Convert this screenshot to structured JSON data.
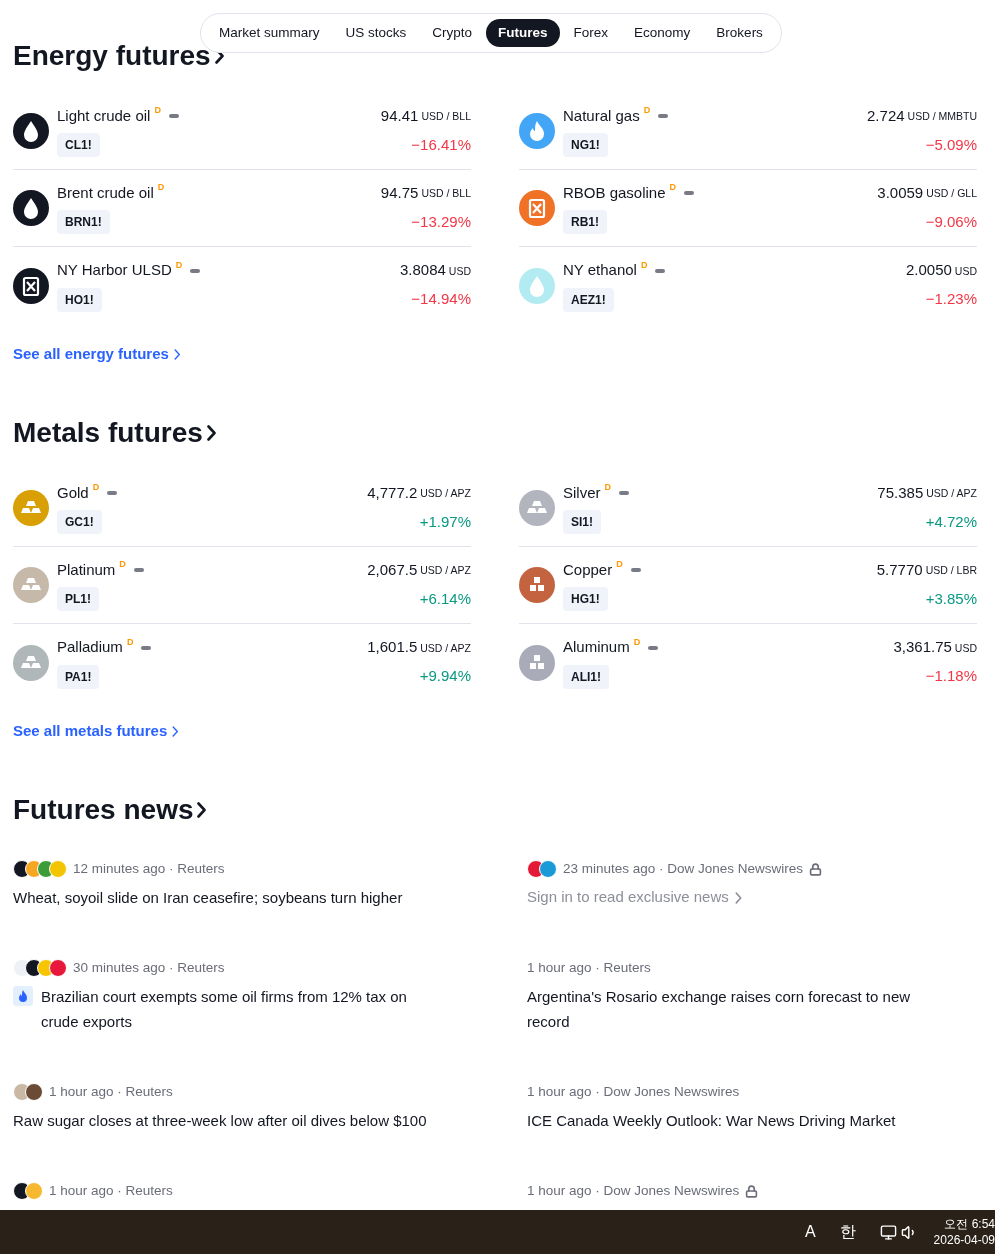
{
  "nav": {
    "tabs": [
      {
        "label": "Market summary",
        "selected": false
      },
      {
        "label": "US stocks",
        "selected": false
      },
      {
        "label": "Crypto",
        "selected": false
      },
      {
        "label": "Futures",
        "selected": true
      },
      {
        "label": "Forex",
        "selected": false
      },
      {
        "label": "Economy",
        "selected": false
      },
      {
        "label": "Brokers",
        "selected": false
      }
    ]
  },
  "sections": [
    {
      "title": "Energy futures",
      "link": "See all energy futures",
      "items": [
        {
          "name": "Light crude oil",
          "badge": "D",
          "dash": true,
          "symbol": "CL1!",
          "price": "94.41",
          "unit": "USD / BLL",
          "change": {
            "value": "−16.41%",
            "color": "#f23645"
          },
          "logo": {
            "kind": "drop",
            "color": "#131722"
          }
        },
        {
          "name": "Natural gas",
          "badge": "D",
          "dash": true,
          "symbol": "NG1!",
          "price": "2.724",
          "unit": "USD / MMBTU",
          "change": {
            "value": "−5.09%",
            "color": "#f23645"
          },
          "logo": {
            "kind": "flame",
            "color": "#42a5f5"
          }
        },
        {
          "name": "Brent crude oil",
          "badge": "D",
          "symbol": "BRN1!",
          "price": "94.75",
          "unit": "USD / BLL",
          "change": {
            "value": "−13.29%",
            "color": "#f23645"
          },
          "logo": {
            "kind": "drop",
            "color": "#131722"
          }
        },
        {
          "name": "RBOB gasoline",
          "badge": "D",
          "dash": true,
          "symbol": "RB1!",
          "price": "3.0059",
          "unit": "USD / GLL",
          "change": {
            "value": "−9.06%",
            "color": "#f23645"
          },
          "logo": {
            "kind": "canister",
            "color": "#f07227"
          }
        },
        {
          "name": "NY Harbor ULSD",
          "badge": "D",
          "dash": true,
          "symbol": "HO1!",
          "price": "3.8084",
          "unit": "USD",
          "change": {
            "value": "−14.94%",
            "color": "#f23645"
          },
          "logo": {
            "kind": "canister",
            "color": "#131722"
          }
        },
        {
          "name": "NY ethanol",
          "badge": "D",
          "dash": true,
          "symbol": "AEZ1!",
          "price": "2.0050",
          "unit": "USD",
          "change": {
            "value": "−1.23%",
            "color": "#f23645"
          },
          "logo": {
            "kind": "drop",
            "color": "#b2ebf2"
          }
        }
      ]
    },
    {
      "title": "Metals futures",
      "link": "See all metals futures",
      "items": [
        {
          "name": "Gold",
          "badge": "D",
          "dash": true,
          "symbol": "GC1!",
          "price": "4,777.2",
          "unit": "USD / APZ",
          "change": {
            "value": "+1.97%",
            "color": "#089981"
          },
          "logo": {
            "kind": "bars",
            "color": "#d9a005"
          }
        },
        {
          "name": "Silver",
          "badge": "D",
          "dash": true,
          "symbol": "SI1!",
          "price": "75.385",
          "unit": "USD / APZ",
          "change": {
            "value": "+4.72%",
            "color": "#089981"
          },
          "logo": {
            "kind": "bars",
            "color": "#b2b5be"
          }
        },
        {
          "name": "Platinum",
          "badge": "D",
          "dash": true,
          "symbol": "PL1!",
          "price": "2,067.5",
          "unit": "USD / APZ",
          "change": {
            "value": "+6.14%",
            "color": "#089981"
          },
          "logo": {
            "kind": "bars",
            "color": "#c6b9a9"
          }
        },
        {
          "name": "Copper",
          "badge": "D",
          "dash": true,
          "symbol": "HG1!",
          "price": "5.7770",
          "unit": "USD / LBR",
          "change": {
            "value": "+3.85%",
            "color": "#089981"
          },
          "logo": {
            "kind": "blocks",
            "color": "#c4633f"
          }
        },
        {
          "name": "Palladium",
          "badge": "D",
          "dash": true,
          "symbol": "PA1!",
          "price": "1,601.5",
          "unit": "USD / APZ",
          "change": {
            "value": "+9.94%",
            "color": "#089981"
          },
          "logo": {
            "kind": "bars",
            "color": "#b0b7b9"
          }
        },
        {
          "name": "Aluminum",
          "badge": "D",
          "dash": true,
          "symbol": "ALI1!",
          "price": "3,361.75",
          "unit": "USD",
          "change": {
            "value": "−1.18%",
            "color": "#f23645"
          },
          "logo": {
            "kind": "blocks",
            "color": "#a9abb8"
          }
        }
      ]
    }
  ],
  "news": {
    "title": "Futures news",
    "items": [
      {
        "kind": "story",
        "logos": [
          {
            "color": "#131722"
          },
          {
            "color": "#f5a623"
          },
          {
            "color": "#3a9d3a"
          },
          {
            "color": "#f5c400"
          }
        ],
        "meta": "12 minutes ago · Reuters",
        "headline": "Wheat, soyoil slide on Iran ceasefire; soybeans turn higher"
      },
      {
        "kind": "signin",
        "logos": [
          {
            "color": "#e31937"
          },
          {
            "color": "#1a9ad6"
          }
        ],
        "meta": "23 minutes ago · Dow Jones Newswires",
        "locked": true,
        "headline": "Sign in to read exclusive news"
      },
      {
        "kind": "story",
        "logos": [
          {
            "color": "#eef1f8"
          },
          {
            "color": "#131722"
          },
          {
            "color": "#f7c600"
          },
          {
            "color": "#e8173c"
          }
        ],
        "meta": "30 minutes ago · Reuters",
        "flame": true,
        "headline": "Brazilian court exempts some oil firms from 12% tax on crude exports"
      },
      {
        "kind": "story",
        "meta": "1 hour ago · Reuters",
        "headline": "Argentina's Rosario exchange raises corn forecast to new record"
      },
      {
        "kind": "story",
        "logos": [
          {
            "color": "#c9b8a5"
          },
          {
            "color": "#6b4a36"
          }
        ],
        "meta": "1 hour ago · Reuters",
        "headline": "Raw sugar closes at three-week low after oil dives below $100"
      },
      {
        "kind": "story",
        "meta": "1 hour ago · Dow Jones Newswires",
        "headline": "ICE Canada Weekly Outlook: War News Driving Market"
      },
      {
        "kind": "meta",
        "logos": [
          {
            "color": "#131722"
          },
          {
            "color": "#f5b82e"
          }
        ],
        "meta": "1 hour ago · Reuters"
      },
      {
        "kind": "meta",
        "meta": "1 hour ago · Dow Jones Newswires",
        "locked": true
      }
    ]
  },
  "taskbar": {
    "keys": [
      "A",
      "한"
    ],
    "time": "오전 6:54",
    "date": "2026-04-09"
  }
}
